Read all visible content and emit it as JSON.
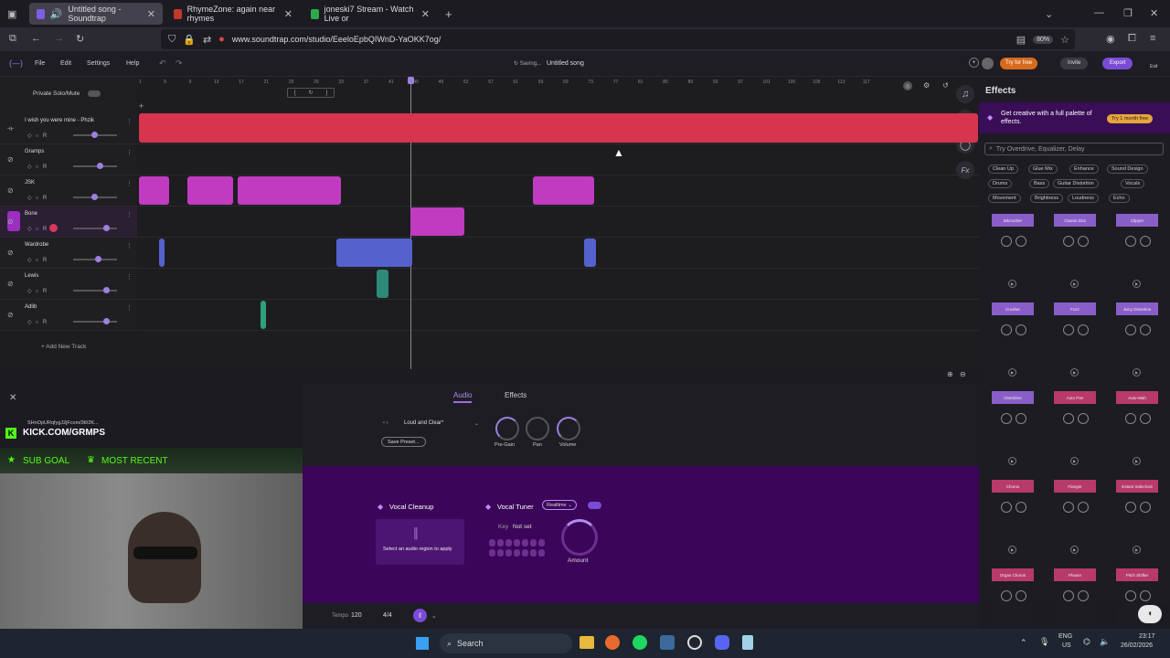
{
  "browser": {
    "tabs": [
      {
        "label": "Untitled song - Soundtrap",
        "color": "#7d5ee0"
      },
      {
        "label": "RhymeZone: again near rhymes",
        "color": "#c0392b"
      },
      {
        "label": "joneski7 Stream - Watch Live or",
        "color": "#2ea84a"
      }
    ],
    "url": "www.soundtrap.com/studio/EeeloEpbQIWnD-YaOKK7og/",
    "zoom": "80%"
  },
  "app": {
    "menu": [
      "File",
      "Edit",
      "Settings",
      "Help"
    ],
    "status": "Saving...",
    "song_title": "Untitled song",
    "try_free": "Try for free",
    "invite": "Invite",
    "export": "Export",
    "exit": "Exit",
    "private_solo": "Private Solo/Mute",
    "add_track": "+ Add New Track"
  },
  "ruler": [
    "1",
    "5",
    "9",
    "13",
    "17",
    "21",
    "25",
    "29",
    "33",
    "37",
    "41",
    "45",
    "49",
    "53",
    "57",
    "61",
    "65",
    "69",
    "73",
    "77",
    "81",
    "85",
    "89",
    "93",
    "97",
    "101",
    "105",
    "109",
    "113",
    "117"
  ],
  "tracks": [
    {
      "name": "I wish you were mine - Phzik",
      "vol": 0.45
    },
    {
      "name": "Gramps",
      "vol": 0.6
    },
    {
      "name": "JSK",
      "vol": 0.45
    },
    {
      "name": "Bone",
      "vol": 0.75
    },
    {
      "name": "Wardrobe",
      "vol": 0.55
    },
    {
      "name": "Lewis",
      "vol": 0.75
    },
    {
      "name": "Adlib",
      "vol": 0.75
    }
  ],
  "effects": {
    "title": "Effects",
    "promo": "Get creative with a full palette of effects.",
    "promo_btn": "Try 1 month free",
    "search_placeholder": "Try Overdrive, Equalizer, Delay",
    "chips": [
      "Clean Up",
      "Glue Mix",
      "Enhance",
      "Sound Design",
      "Drums",
      "Bass",
      "Guitar Distortion",
      "Vocals",
      "Movement",
      "Brightness",
      "Loudness",
      "Echo"
    ],
    "cards": [
      "Bitcrusher",
      "Classic Dist",
      "Clipper",
      "Crusher",
      "Fuzz",
      "Juicy Distortion",
      "Overdrive",
      "Auto Pan",
      "Auto-Wah",
      "Chorus",
      "Flanger",
      "Instant Sidechain",
      "Organ Chorus",
      "Phaser",
      "Pitch Shifter"
    ]
  },
  "bottom": {
    "tab_audio": "Audio",
    "tab_effects": "Effects",
    "preset": "Loud and Clear*",
    "save_preset": "Save Preset...",
    "knobs": [
      "Pre-Gain",
      "Pan",
      "Volume"
    ],
    "vocal_cleanup": "Vocal Cleanup",
    "cleanup_hint": "Select an audio region to apply",
    "vocal_tuner": "Vocal Tuner",
    "realtime": "Realtime",
    "key_label": "Key",
    "key_value": "Not set",
    "amount": "Amount",
    "tempo_label": "Tempo",
    "tempo": "120",
    "time_sig": "4/4"
  },
  "overlay": {
    "handle": "SHnOpURqfygJ2jFcom/3tI/2K...",
    "kick": "KICK.COM/GRMPS",
    "sub_goal": "SUB GOAL",
    "most_recent": "MOST RECENT"
  },
  "taskbar": {
    "search": "Search",
    "lang": "ENG",
    "region": "US",
    "time": "23:17",
    "date": "26/02/2026"
  }
}
